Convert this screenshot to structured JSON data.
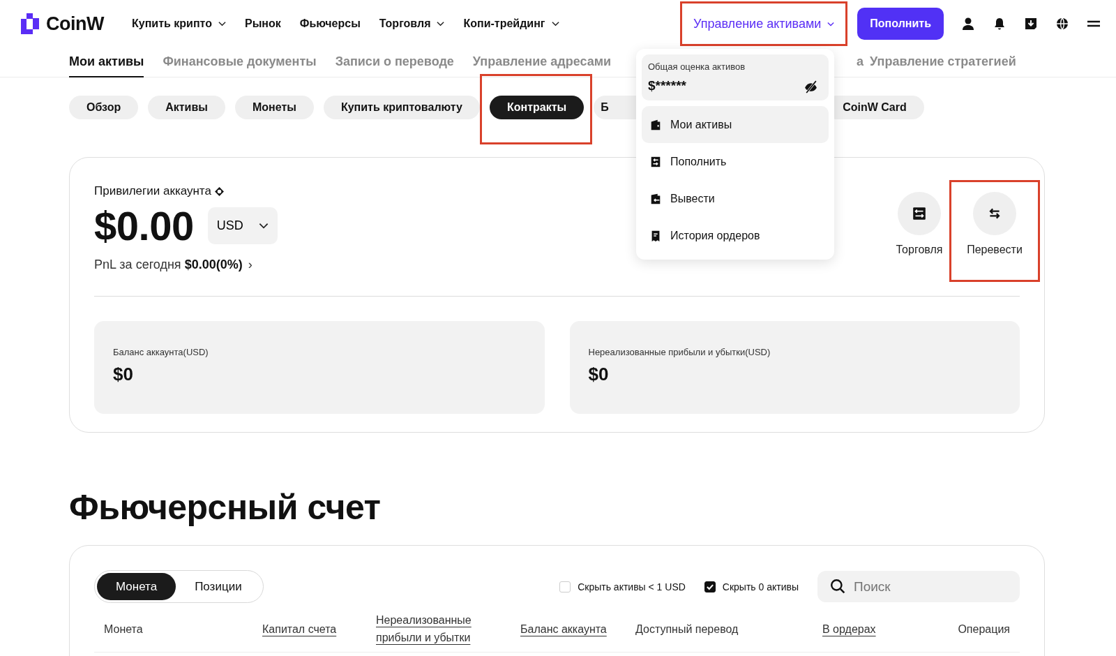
{
  "header": {
    "logo": "CoinW",
    "nav": [
      {
        "label": "Купить крипто",
        "dropdown": true
      },
      {
        "label": "Рынок",
        "dropdown": false
      },
      {
        "label": "Фьючерсы",
        "dropdown": false
      },
      {
        "label": "Торговля",
        "dropdown": true
      },
      {
        "label": "Копи-трейдинг",
        "dropdown": true
      }
    ],
    "assets_menu": {
      "label": "Управление активами",
      "highlighted": true,
      "expanded": true
    },
    "deposit_button": "Пополнить"
  },
  "tabs": [
    {
      "label": "Мои активы",
      "selected": true
    },
    {
      "label": "Финансовые документы",
      "selected": false
    },
    {
      "label": "Записи о переводе",
      "selected": false
    },
    {
      "label": "Управление адресами",
      "selected": false
    },
    {
      "label": "а",
      "selected": false
    },
    {
      "label": "Управление стратегией",
      "selected": false
    }
  ],
  "pills": [
    {
      "label": "Обзор",
      "selected": false,
      "highlighted": false
    },
    {
      "label": "Активы",
      "selected": false,
      "highlighted": false
    },
    {
      "label": "Монеты",
      "selected": false,
      "highlighted": false
    },
    {
      "label": "Купить криптовалюту",
      "selected": false,
      "highlighted": false
    },
    {
      "label": "Контракты",
      "selected": true,
      "highlighted": true
    },
    {
      "label": "Б",
      "selected": false,
      "highlighted": false
    },
    {
      "label": "CoinW Card",
      "selected": false,
      "highlighted": false
    }
  ],
  "dropdown": {
    "total_label": "Общая оценка активов",
    "total_value": "$******",
    "items": [
      {
        "label": "Мои активы",
        "selected": true
      },
      {
        "label": "Пополнить",
        "selected": false
      },
      {
        "label": "Вывести",
        "selected": false
      },
      {
        "label": "История ордеров",
        "selected": false
      }
    ]
  },
  "overview": {
    "title": "Привилегии аккаунта",
    "amount": "$0.00",
    "currency": "USD",
    "pnl": "PnL за сегодня **$0.00(0%)**",
    "pnl_arrow": "›",
    "actions": [
      {
        "label": "Торговля",
        "highlighted": false
      },
      {
        "label": "Перевести",
        "highlighted": true
      }
    ],
    "stats": [
      {
        "label": "Баланс аккаунта(USD)",
        "value": "$0"
      },
      {
        "label": "Нереализованные прибыли и убытки(USD)",
        "value": "$0"
      }
    ]
  },
  "futures": {
    "title": "Фьючерсный счет",
    "segments": [
      {
        "label": "Монета",
        "selected": true
      },
      {
        "label": "Позиции",
        "selected": false
      }
    ],
    "filters": [
      {
        "label": "Скрыть активы < 1 USD",
        "checked": false
      },
      {
        "label": "Скрыть 0 активы",
        "checked": true
      }
    ],
    "search": {
      "placeholder": "Поиск"
    },
    "columns": [
      {
        "label": "Монета",
        "underlined": false
      },
      {
        "label": "Капитал счета",
        "underlined": true
      },
      {
        "label": "Нереализованные прибыли и убытки",
        "underlined": true
      },
      {
        "label": "Баланс аккаунта",
        "underlined": true
      },
      {
        "label": "Доступный перевод",
        "underlined": false
      },
      {
        "label": "В ордерах",
        "underlined": true
      },
      {
        "label": "Операция",
        "underlined": false
      }
    ]
  }
}
